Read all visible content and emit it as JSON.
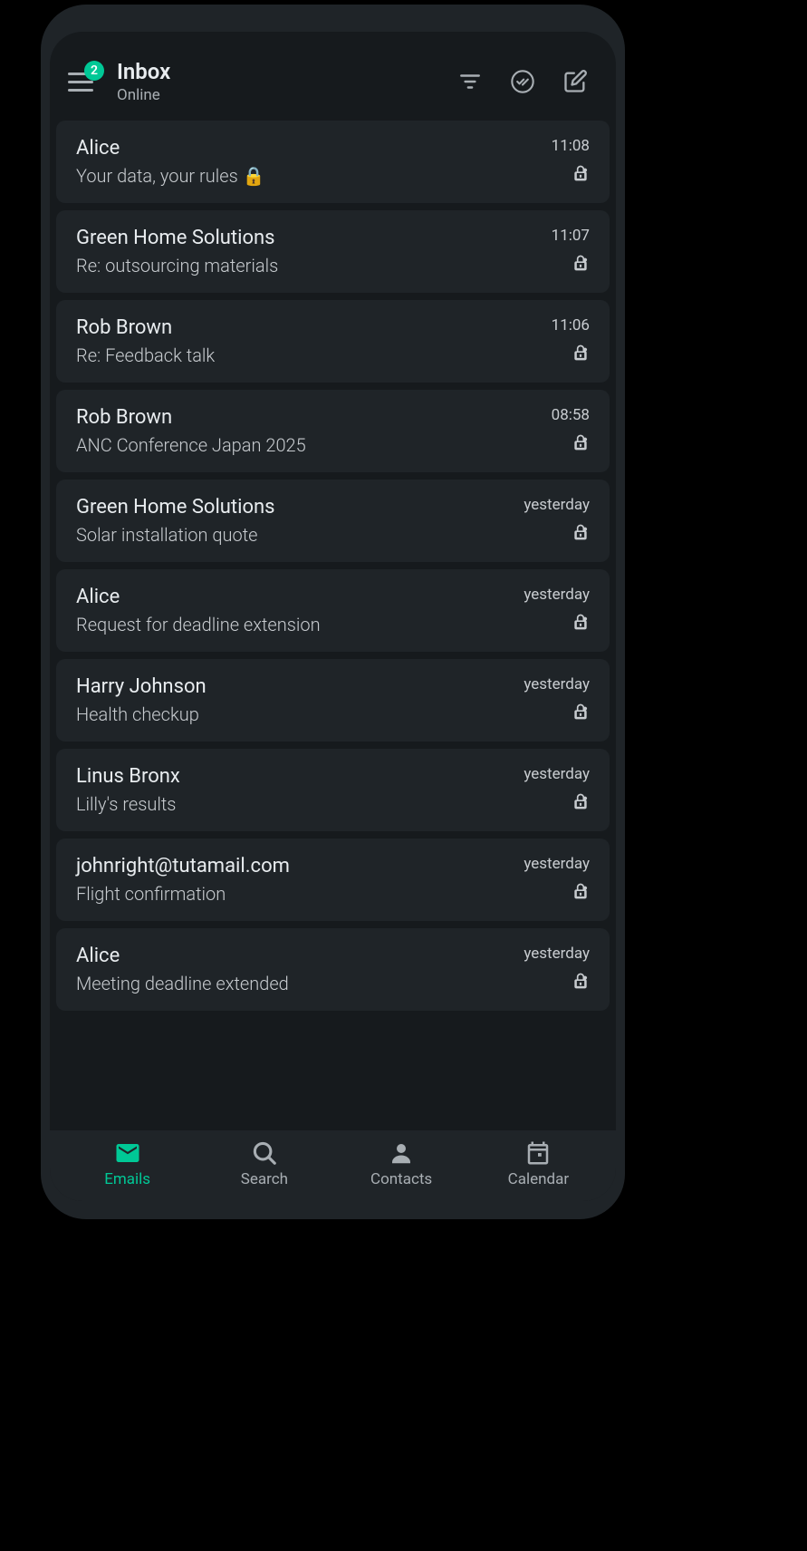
{
  "header": {
    "title": "Inbox",
    "subtitle": "Online",
    "badge": "2"
  },
  "emails": [
    {
      "sender": "Alice",
      "subject": "Your data, your rules 🔒",
      "time": "11:08"
    },
    {
      "sender": "Green Home Solutions",
      "subject": "Re: outsourcing materials",
      "time": "11:07"
    },
    {
      "sender": "Rob Brown",
      "subject": "Re: Feedback talk",
      "time": "11:06"
    },
    {
      "sender": "Rob Brown",
      "subject": "ANC Conference Japan 2025",
      "time": "08:58"
    },
    {
      "sender": "Green Home Solutions",
      "subject": "Solar installation quote",
      "time": "yesterday"
    },
    {
      "sender": "Alice",
      "subject": "Request for deadline extension",
      "time": "yesterday"
    },
    {
      "sender": "Harry Johnson",
      "subject": "Health checkup",
      "time": "yesterday"
    },
    {
      "sender": "Linus Bronx",
      "subject": "Lilly's results",
      "time": "yesterday"
    },
    {
      "sender": "johnright@tutamail.com",
      "subject": "Flight confirmation",
      "time": "yesterday"
    },
    {
      "sender": "Alice",
      "subject": "Meeting deadline extended",
      "time": "yesterday"
    }
  ],
  "nav": {
    "emails": "Emails",
    "search": "Search",
    "contacts": "Contacts",
    "calendar": "Calendar"
  }
}
